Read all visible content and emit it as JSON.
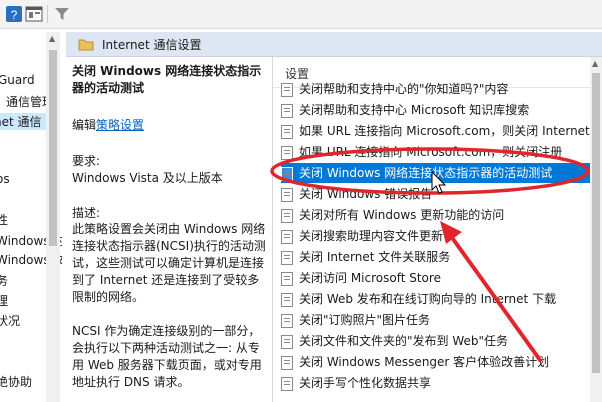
{
  "toolbar": {
    "icons": [
      "help-icon",
      "properties-icon",
      "filter-icon"
    ]
  },
  "tree": {
    "items": [
      {
        "label": "Guard"
      },
      {
        "label": "通信管理"
      },
      {
        "label": "net 通信",
        "selected": true
      },
      {
        "label": "os"
      },
      {
        "label": "性"
      },
      {
        "label": "Windows 时间服务"
      },
      {
        "label": "Windows 文件"
      },
      {
        "label": "务"
      },
      {
        "label": "理"
      },
      {
        "label": "状况"
      },
      {
        "label": "绝协助"
      }
    ]
  },
  "header": {
    "title": "Internet 通信设置"
  },
  "description": {
    "title": "关闭 Windows 网络连接状态指示器的活动测试",
    "edit_prefix": "编辑",
    "edit_link": "策略设置",
    "req_label": "要求:",
    "req_value": "Windows Vista 及以上版本",
    "desc_label": "描述:",
    "para1": "此策略设置会关闭由 Windows 网络连接状态指示器(NCSI)执行的活动测试，这些测试可以确定计算机是连接到了 Internet 还是连接到了受较多限制的网络。",
    "para2": "NCSI 作为确定连接级别的一部分，会执行以下两种活动测试之一: 从专用 Web 服务器下载页面，或对专用地址执行 DNS 请求。"
  },
  "list": {
    "header": "设置",
    "items": [
      {
        "label": "关闭帮助和支持中心的\"你知道吗?\"内容"
      },
      {
        "label": "关闭帮助和支持中心 Microsoft 知识库搜索"
      },
      {
        "label": "如果 URL 连接指向 Microsoft.com，则关闭 Internet"
      },
      {
        "label": "如果 URL 连接指向 Microsoft.com，则关闭注册"
      },
      {
        "label": "关闭 Windows 网络连接状态指示器的活动测试",
        "selected": true
      },
      {
        "label": "关闭 Windows 错误报告"
      },
      {
        "label": "关闭对所有 Windows 更新功能的访问"
      },
      {
        "label": "关闭搜索助理内容文件更新"
      },
      {
        "label": "关闭 Internet 文件关联服务"
      },
      {
        "label": "关闭访问 Microsoft Store"
      },
      {
        "label": "关闭 Web 发布和在线订购向导的 Internet 下载"
      },
      {
        "label": "关闭\"订购照片\"图片任务"
      },
      {
        "label": "关闭文件和文件夹的\"发布到 Web\"任务"
      },
      {
        "label": "关闭 Windows Messenger 客户体验改善计划"
      },
      {
        "label": "关闭手写个性化数据共享"
      }
    ]
  },
  "colors": {
    "annotation_red": "#e0262b",
    "selection_blue": "#0078d7",
    "header_bg": "#dde6f2"
  }
}
